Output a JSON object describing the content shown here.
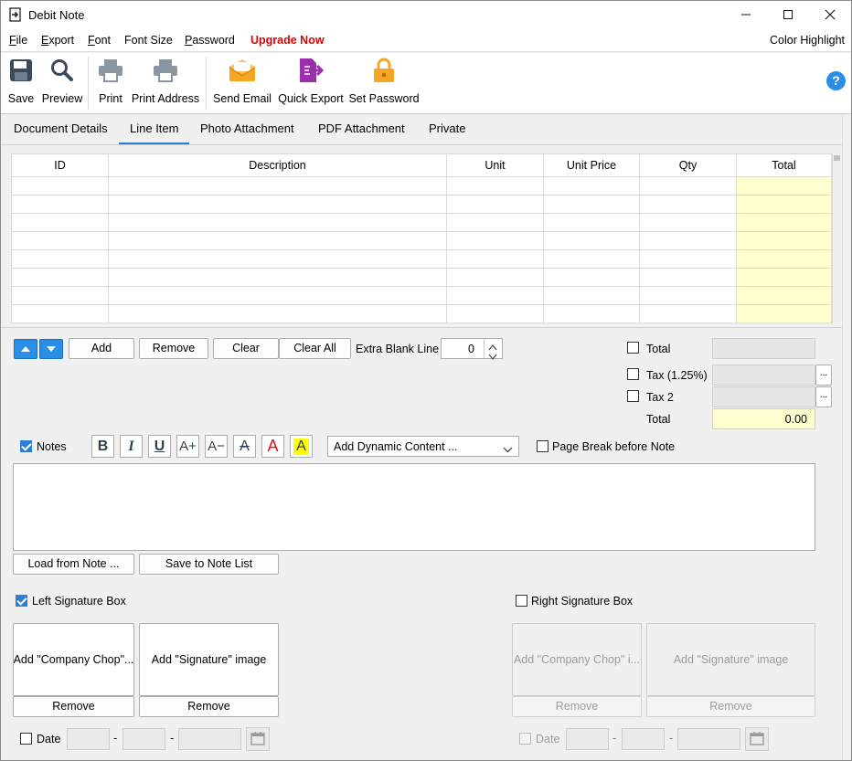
{
  "window": {
    "title": "Debit Note"
  },
  "menu": {
    "items": [
      "File",
      "Export",
      "Font",
      "Font Size",
      "Password"
    ],
    "upgrade": "Upgrade Now",
    "upgrade_color": "#e00000",
    "right": "Color Highlight"
  },
  "toolbar": {
    "save": "Save",
    "preview": "Preview",
    "print": "Print",
    "print_address": "Print Address",
    "send_email": "Send Email",
    "quick_export": "Quick Export",
    "set_password": "Set Password",
    "help": "?"
  },
  "tabs": [
    "Document Details",
    "Line Item",
    "Photo Attachment",
    "PDF Attachment",
    "Private"
  ],
  "active_tab": "Line Item",
  "grid": {
    "columns": [
      "ID",
      "Description",
      "Unit",
      "Unit Price",
      "Qty",
      "Total"
    ],
    "row_count": 8
  },
  "line_buttons": {
    "add": "Add",
    "remove": "Remove",
    "clear": "Clear",
    "clear_all": "Clear All",
    "extra_blank_label": "Extra Blank Line",
    "extra_blank_value": "0"
  },
  "totals": {
    "total_check": "Total",
    "tax1": "Tax (1.25%)",
    "tax2": "Tax 2",
    "total_label": "Total",
    "total_value": "0.00",
    "ellipsis": "..."
  },
  "notes": {
    "label": "Notes",
    "dynamic_content": "Add Dynamic Content ...",
    "page_break": "Page Break before Note",
    "load": "Load from Note ...",
    "save": "Save to Note List"
  },
  "format_buttons": [
    "B",
    "I",
    "U",
    "A+",
    "A−",
    "A",
    "A",
    "A"
  ],
  "signature": {
    "left_label": "Left Signature Box",
    "right_label": "Right Signature Box",
    "company_chop": "Add \"Company Chop\"...",
    "company_chop_right": "Add \"Company Chop\" i...",
    "signature_image": "Add \"Signature\" image",
    "remove": "Remove",
    "date": "Date"
  },
  "colors": {
    "accent": "#2b7fd8",
    "highlight_yellow": "#ffffd0"
  }
}
